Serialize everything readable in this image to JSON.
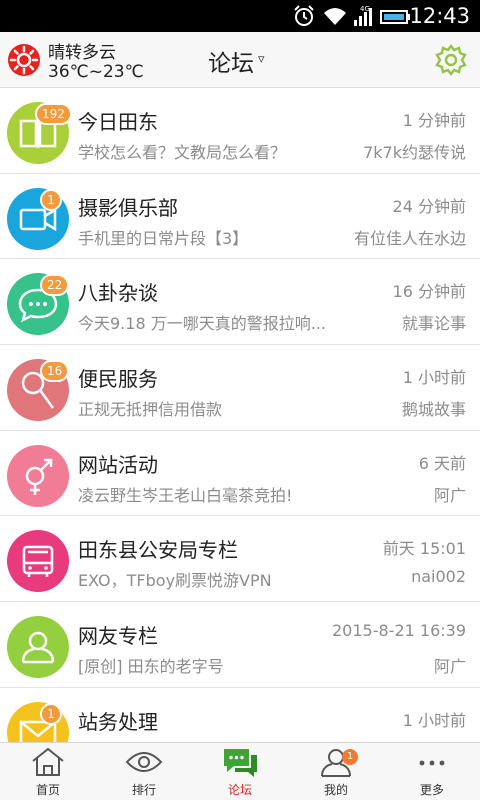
{
  "status_bar": {
    "time": "12:43",
    "network": "4G"
  },
  "header": {
    "weather_desc": "晴转多云",
    "weather_temp": "36℃~23℃",
    "title": "论坛",
    "caret": "▿"
  },
  "forums": [
    {
      "title": "今日田东",
      "subtitle": "学校怎么看？文教局怎么看？",
      "time": "1 分钟前",
      "author": "7k7k约瑟传说",
      "badge": "192",
      "color": "#a9cf3a",
      "icon": "book-icon"
    },
    {
      "title": "摄影俱乐部",
      "subtitle": "手机里的日常片段【3】",
      "time": "24 分钟前",
      "author": "有位佳人在水边",
      "badge": "1",
      "color": "#1aa5dd",
      "icon": "video-camera-icon"
    },
    {
      "title": "八卦杂谈",
      "subtitle": "今天9.18  万一哪天真的警报拉响...",
      "time": "16 分钟前",
      "author": "就事论事",
      "badge": "22",
      "color": "#36c28a",
      "icon": "chat-bubble-icon"
    },
    {
      "title": "便民服务",
      "subtitle": "正规无抵押信用借款",
      "time": "1 小时前",
      "author": "鹅城故事",
      "badge": "16",
      "color": "#e0757a",
      "icon": "magnifier-icon"
    },
    {
      "title": "网站活动",
      "subtitle": "凌云野生岑王老山白毫茶竞拍!",
      "time": "6 天前",
      "author": "阿广",
      "badge": "",
      "color": "#f07c96",
      "icon": "gender-icon"
    },
    {
      "title": "田东县公安局专栏",
      "subtitle": "EXO，TFboy刷票悦游VPN",
      "time": "前天 15:01",
      "author": "nai002",
      "badge": "",
      "color": "#e83b7e",
      "icon": "bus-icon"
    },
    {
      "title": "网友专栏",
      "subtitle": "[原创] 田东的老字号",
      "time": "2015-8-21 16:39",
      "author": "阿广",
      "badge": "",
      "color": "#93cf3f",
      "icon": "user-icon"
    },
    {
      "title": "站务处理",
      "subtitle": "",
      "time": "1 小时前",
      "author": "",
      "badge": "1",
      "color": "#f3c21d",
      "icon": "envelope-icon"
    }
  ],
  "bottom_nav": [
    {
      "label": "首页",
      "icon": "home-icon",
      "active": false
    },
    {
      "label": "排行",
      "icon": "eye-icon",
      "active": false
    },
    {
      "label": "论坛",
      "icon": "forum-chat-icon",
      "active": true
    },
    {
      "label": "我的",
      "icon": "profile-icon",
      "active": false,
      "badge": "1"
    },
    {
      "label": "更多",
      "icon": "more-dots-icon",
      "active": false
    }
  ],
  "colors": {
    "accent": "#3fa33a",
    "active_label": "#dd2222",
    "badge": "#f39a3a"
  }
}
